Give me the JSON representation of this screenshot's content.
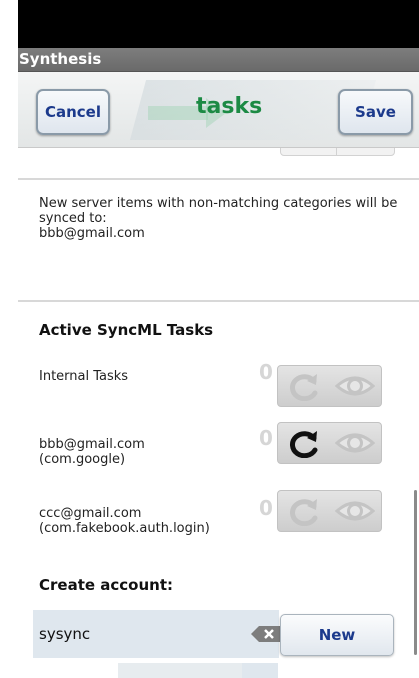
{
  "app": {
    "title": "Synthesis"
  },
  "header": {
    "cancel_label": "Cancel",
    "title": "tasks",
    "save_label": "Save"
  },
  "info": {
    "text": "New server items with non-matching categories will be synced to:\nbbb@gmail.com"
  },
  "active_tasks": {
    "title": "Active SyncML Tasks",
    "rows": [
      {
        "label": "Internal Tasks",
        "count": "0",
        "sync_enabled": false
      },
      {
        "label": "bbb@gmail.com\n(com.google)",
        "count": "0",
        "sync_enabled": true
      },
      {
        "label": "ccc@gmail.com\n(com.fakebook.auth.login)",
        "count": "0",
        "sync_enabled": false
      }
    ]
  },
  "create_account": {
    "title": "Create account:",
    "input_value": "sysync",
    "new_label": "New"
  },
  "icons": {
    "sync": "sync-icon",
    "view": "eye-icon",
    "clear": "clear-text-icon"
  },
  "colors": {
    "title_green": "#1c8a44",
    "button_text": "#1c3a8c",
    "disabled_icon": "#d6d6d6"
  }
}
